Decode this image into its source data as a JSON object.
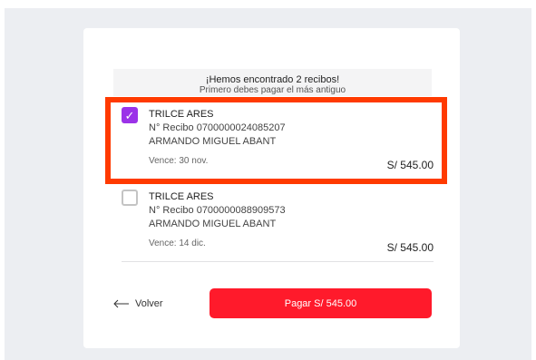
{
  "notice": {
    "title": "¡Hemos encontrado 2 recibos!",
    "subtitle": "Primero debes pagar el más antiguo"
  },
  "receipts": [
    {
      "checked": true,
      "company": "TRILCE ARES",
      "receipt_number": "N° Recibo 0700000024085207",
      "holder": "ARMANDO MIGUEL ABANT",
      "due": "Vence: 30 nov.",
      "amount": "S/ 545.00"
    },
    {
      "checked": false,
      "company": "TRILCE ARES",
      "receipt_number": "N° Recibo 0700000088909573",
      "holder": "ARMANDO MIGUEL ABANT",
      "due": "Vence: 14 dic.",
      "amount": "S/ 545.00"
    }
  ],
  "actions": {
    "back_label": "Volver",
    "pay_label": "Pagar S/ 545.00"
  },
  "colors": {
    "highlight": "#ff3a00",
    "checkbox_checked": "#9b32e8",
    "pay_button": "#ff1a2b"
  },
  "icons": {
    "back": "arrow-left-icon",
    "check": "checkmark-icon"
  }
}
